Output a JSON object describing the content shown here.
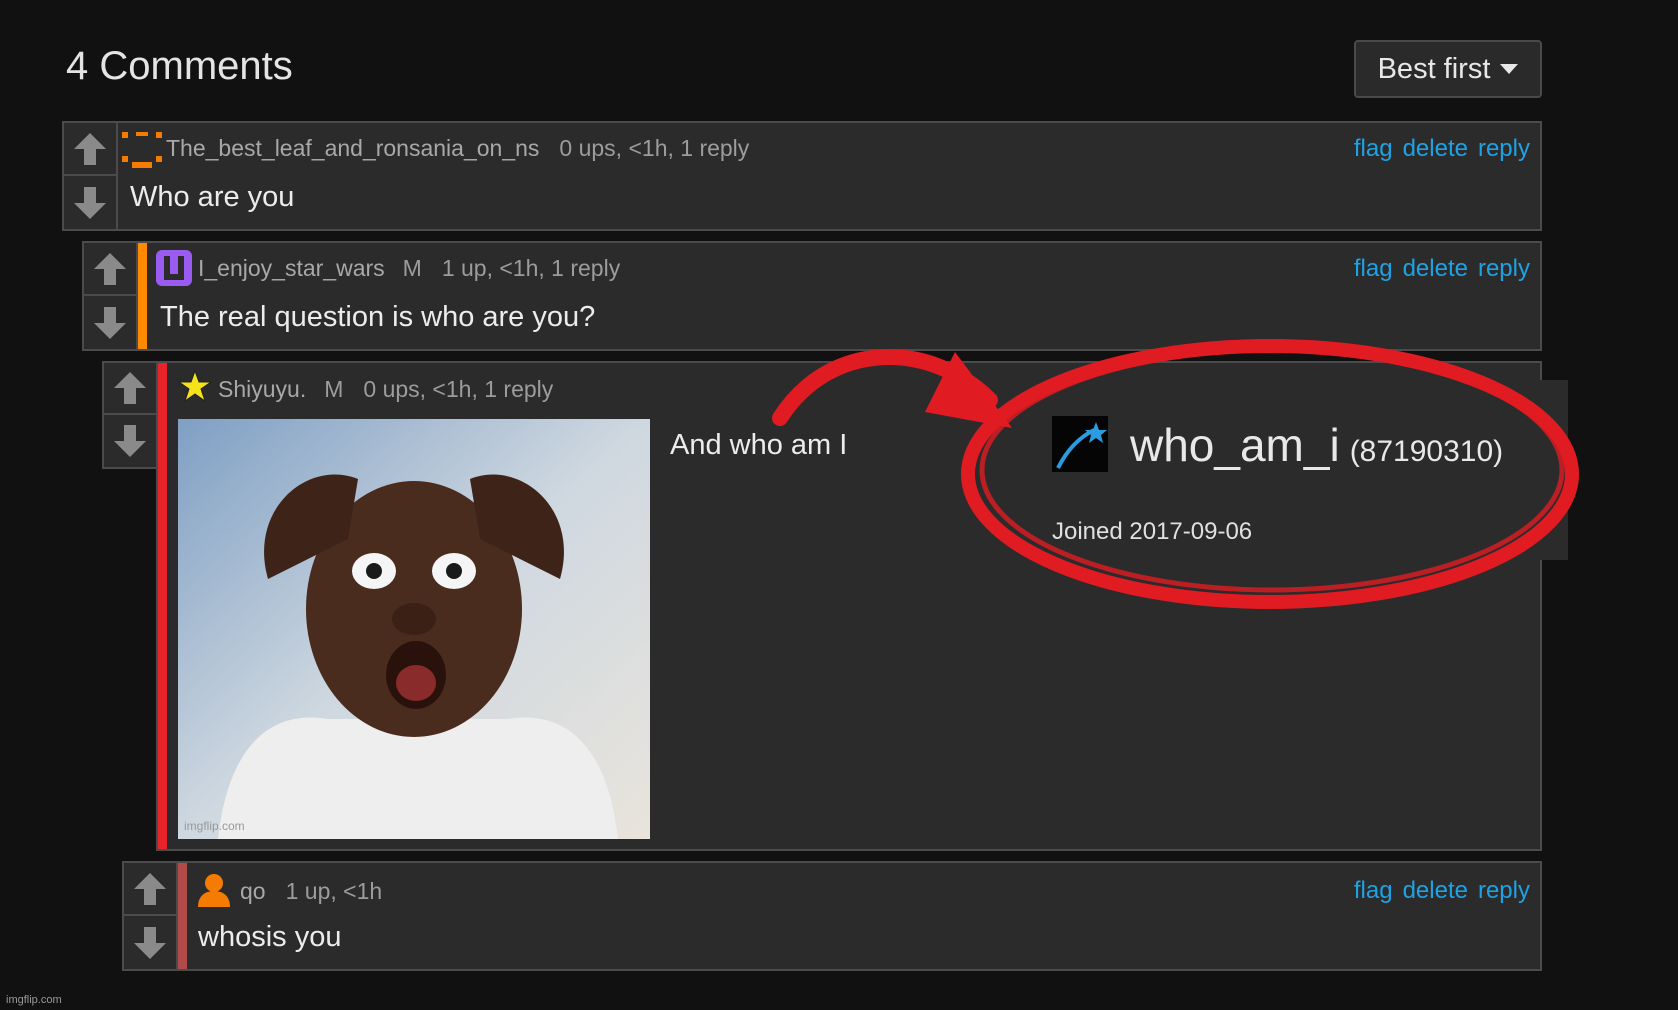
{
  "header": {
    "title": "4 Comments",
    "sort_label": "Best first"
  },
  "actions": {
    "flag": "flag",
    "delete": "delete",
    "reply": "reply"
  },
  "comments": [
    {
      "user": "The_best_leaf_and_ronsania_on_ns",
      "meta": "0 ups, <1h, 1 reply",
      "text": "Who are you",
      "accent": "#f57c00"
    },
    {
      "user": "I_enjoy_star_wars",
      "mod": "M",
      "meta": "1 up, <1h, 1 reply",
      "text": "The real question is who are you?",
      "accent": "#ff8a00"
    },
    {
      "user": "Shiyuyu.",
      "mod": "M",
      "meta": "0 ups, <1h, 1 reply",
      "text": "And who am I",
      "accent": "#e8242a"
    },
    {
      "user": "qo",
      "meta": "1 up, <1h",
      "text": "whosis you",
      "accent": "#b24a4a"
    }
  ],
  "popup": {
    "username": "who_am_i",
    "user_id": "(87190310)",
    "joined": "Joined 2017-09-06"
  },
  "annotation_color": "#e01b22",
  "watermark": "imgflip.com",
  "image_credit": "imgflip.com"
}
